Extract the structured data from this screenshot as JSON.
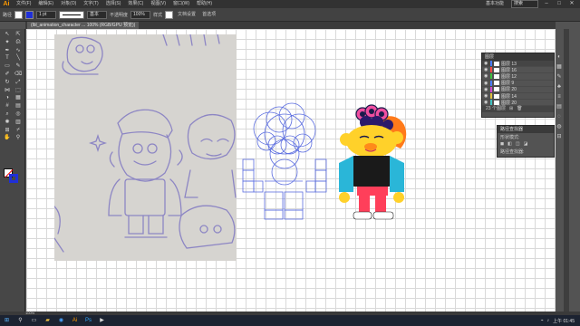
{
  "app": {
    "logo": "Ai"
  },
  "menubar": {
    "items": [
      "文件(F)",
      "编辑(E)",
      "对象(O)",
      "文字(T)",
      "选择(S)",
      "效果(C)",
      "视图(V)",
      "窗口(W)",
      "帮助(H)"
    ],
    "workspace": "基本功能",
    "search_placeholder": "搜索"
  },
  "control_bar": {
    "object_label": "路径",
    "stroke_weight": "1 pt",
    "stroke_type": "基本",
    "opacity_label": "不透明度",
    "opacity_value": "100%",
    "style_label": "样式",
    "doc_setup": "文档设置",
    "preferences": "首选项"
  },
  "document_tab": {
    "label": "(lbl_animation_character ... 100% (RGB/GPU 预览))"
  },
  "layers_panel": {
    "title": "图层",
    "layers": [
      {
        "name": "图层 13",
        "color": "#4a7bff"
      },
      {
        "name": "图层 16",
        "color": "#ff4a4a"
      },
      {
        "name": "图层 12",
        "color": "#40c040"
      },
      {
        "name": "图层 9",
        "color": "#4a7bff"
      },
      {
        "name": "图层 20",
        "color": "#d04ad0"
      },
      {
        "name": "图层 14",
        "color": "#e0c040"
      },
      {
        "name": "图层 20",
        "color": "#40c0c0"
      }
    ],
    "footer": "23 个图层"
  },
  "panel2": {
    "title": "路径查找器",
    "row1": "形状模式:",
    "row2": "路径查找器:"
  },
  "status": {
    "zoom": "100%"
  },
  "taskbar": {
    "time": "上午 01:45"
  },
  "colors": {
    "accent": "#ff9a00",
    "stroke": "#1f2fd8",
    "construction": "#5c6ee0",
    "sketch": "#8d86c4"
  }
}
